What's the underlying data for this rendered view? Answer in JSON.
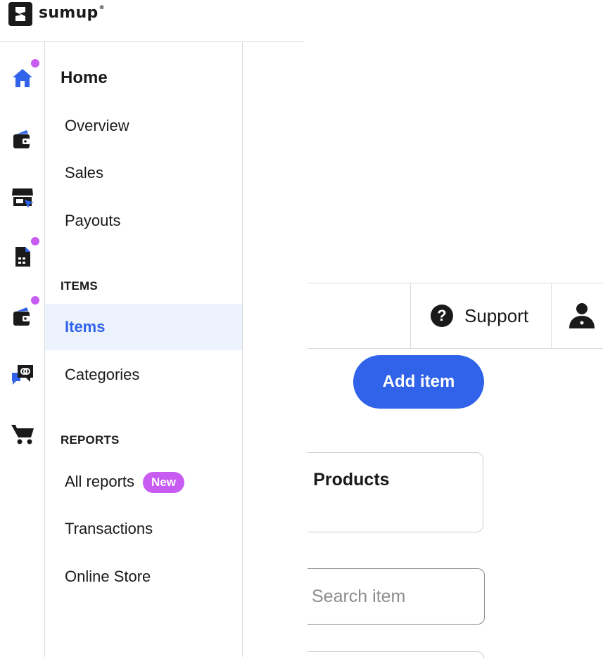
{
  "brand": {
    "name": "sumup",
    "trademark": "®"
  },
  "colors": {
    "accent": "#3063e9",
    "badge": "#c85cf2",
    "active_bg": "#edf3fd"
  },
  "rail": [
    {
      "icon": "home-icon",
      "has_dot": true
    },
    {
      "icon": "wallet-icon",
      "has_dot": false
    },
    {
      "icon": "storefront-icon",
      "has_dot": false
    },
    {
      "icon": "document-icon",
      "has_dot": true
    },
    {
      "icon": "wallet-icon",
      "has_dot": true
    },
    {
      "icon": "chat-link-icon",
      "has_dot": false
    },
    {
      "icon": "cart-icon",
      "has_dot": false
    }
  ],
  "nav": {
    "title": "Home",
    "home_items": [
      "Overview",
      "Sales",
      "Payouts"
    ],
    "items_section": "ITEMS",
    "items": [
      "Items",
      "Categories"
    ],
    "active_item": "Items",
    "reports_section": "REPORTS",
    "reports": [
      "All reports",
      "Transactions",
      "Online Store"
    ],
    "new_badge": "New"
  },
  "header": {
    "support_label": "Support",
    "help_icon_glyph": "?"
  },
  "main": {
    "add_item_label": "Add item",
    "card_title": "g Products",
    "search_placeholder": "Search item"
  }
}
